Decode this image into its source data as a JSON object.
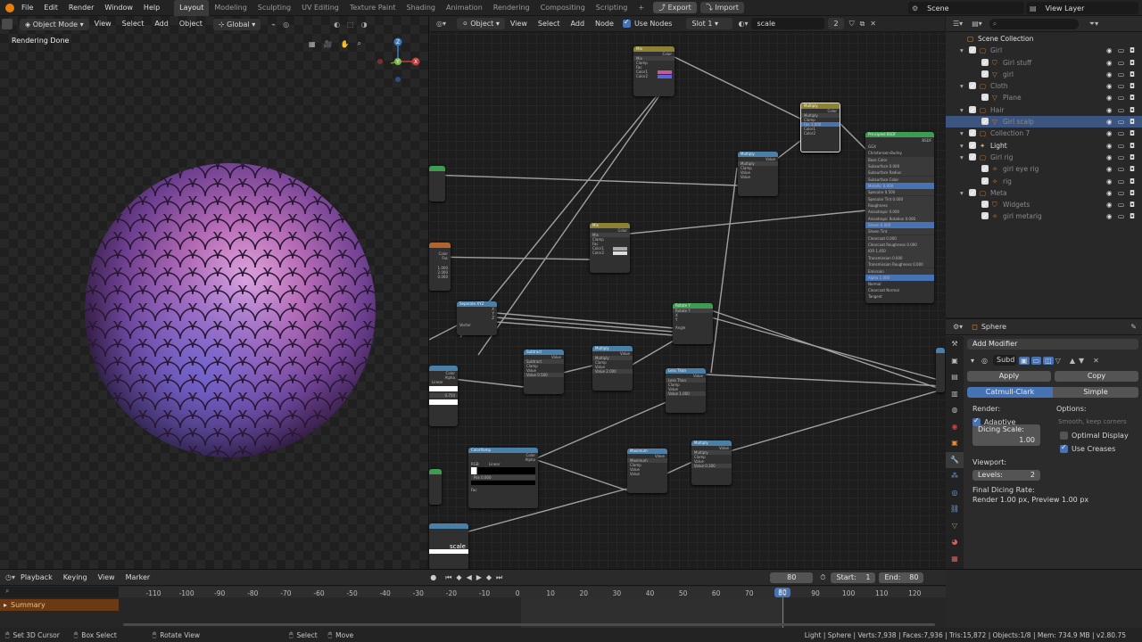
{
  "topbar": {
    "menus": [
      "File",
      "Edit",
      "Render",
      "Window",
      "Help"
    ],
    "workspaces": [
      "Layout",
      "Modeling",
      "Sculpting",
      "UV Editing",
      "Texture Paint",
      "Shading",
      "Animation",
      "Rendering",
      "Compositing",
      "Scripting"
    ],
    "active_workspace": "Layout",
    "plus": "+",
    "export_label": "Export",
    "import_label": "Import",
    "scene_label": "Scene",
    "view_layer_label": "View Layer"
  },
  "viewport": {
    "mode": "Object Mode",
    "menus": [
      "View",
      "Select",
      "Add",
      "Object"
    ],
    "transform": "Global",
    "status_text": "Rendering Done",
    "axis_z": "Z",
    "axis_y": "Y",
    "axis_x": "X"
  },
  "node_editor": {
    "object_dropdown": "Object",
    "menus": [
      "View",
      "Select",
      "Add",
      "Node"
    ],
    "use_nodes_label": "Use Nodes",
    "slot": "Slot 1",
    "material_name": "scale",
    "user_count": "2",
    "nodes": [
      {
        "title": "Mix",
        "color": "#8c8235",
        "rows": [
          "Color",
          "Mix",
          "Clamp",
          "Fac",
          "Color1",
          "Color2"
        ]
      },
      {
        "title": "Multiply",
        "color": "#8c8235",
        "rows": [
          "Color",
          "Multiply",
          "Clamp",
          "Fac 1.000",
          "Color1",
          "Color2"
        ]
      },
      {
        "title": "Principled BSDF",
        "color": "#3e9b52",
        "rows": [
          "BSDF",
          "GGX",
          "Christensen-Burley",
          "Base Color",
          "Subsurface 0.000",
          "Subsurface Radius",
          "Subsurface Color",
          "Metallic 0.000",
          "Specular 0.500",
          "Specular Tint 0.000",
          "Roughness",
          "Anisotropic 0.000",
          "Anisotropic Rotation 0.000",
          "Sheen 0.000",
          "Sheen Tint",
          "Clearcoat 0.000",
          "Clearcoat Roughness 0.000",
          "IOR 1.450",
          "Transmission 0.000",
          "Transmission Roughness 0.000",
          "Emission",
          "Alpha 1.000",
          "Normal",
          "Clearcoat Normal",
          "Tangent"
        ]
      },
      {
        "title": "Multiply",
        "color": "#4a7fa8",
        "rows": [
          "Value",
          "Multiply",
          "Clamp",
          "Value",
          "Value"
        ]
      },
      {
        "title": "Mix",
        "color": "#8c8235",
        "rows": [
          "Color",
          "Mix",
          "Clamp",
          "Fac",
          "Color1",
          "Color2"
        ]
      },
      {
        "title": "Separate XYZ",
        "color": "#4a7fa8",
        "rows": [
          "X",
          "Y",
          "Z",
          "Vector"
        ]
      },
      {
        "title": "Rotate Y",
        "color": "#3e9b52",
        "rows": [
          "Rotate Y",
          "X",
          "Y",
          "Angle"
        ]
      },
      {
        "title": "Subtract",
        "color": "#4a7fa8",
        "rows": [
          "Value",
          "Subtract",
          "Clamp",
          "Value",
          "Value 0.500"
        ]
      },
      {
        "title": "Multiply",
        "color": "#4a7fa8",
        "rows": [
          "Value",
          "Multiply",
          "Clamp",
          "Value",
          "Value 2.000"
        ]
      },
      {
        "title": "Less Than",
        "color": "#4a7fa8",
        "rows": [
          "Value",
          "Less Than",
          "Clamp",
          "Value",
          "Value 1.000"
        ]
      },
      {
        "title": "ColorRamp",
        "color": "#4a7fa8",
        "rows": [
          "Color",
          "Alpha",
          "RGB",
          "Linear",
          "Pos 0.000",
          "Fac"
        ]
      },
      {
        "title": "Maximum",
        "color": "#4a7fa8",
        "rows": [
          "Value",
          "Maximum",
          "Clamp",
          "Value",
          "Value"
        ]
      },
      {
        "title": "Multiply",
        "color": "#4a7fa8",
        "rows": [
          "Value",
          "Multiply",
          "Clamp",
          "Value",
          "Value 0.300"
        ]
      }
    ],
    "partial_labels": [
      "Color",
      "Alpha",
      "Linear",
      "0.750",
      "scale",
      "Color",
      "Fac",
      "1.000",
      "2.000",
      "0.000"
    ]
  },
  "outliner": {
    "rows": [
      {
        "label": "Scene Collection",
        "indent": 0,
        "dim": false,
        "sel": false
      },
      {
        "label": "Girl",
        "indent": 1,
        "dim": true,
        "sel": false
      },
      {
        "label": "Girl stuff",
        "indent": 2,
        "dim": true,
        "sel": false
      },
      {
        "label": "girl",
        "indent": 2,
        "dim": true,
        "sel": false
      },
      {
        "label": "Cloth",
        "indent": 1,
        "dim": true,
        "sel": false
      },
      {
        "label": "Plane",
        "indent": 2,
        "dim": true,
        "sel": false
      },
      {
        "label": "Hair",
        "indent": 1,
        "dim": true,
        "sel": false
      },
      {
        "label": "Girl scalp",
        "indent": 2,
        "dim": true,
        "sel": true
      },
      {
        "label": "Collection 7",
        "indent": 1,
        "dim": true,
        "sel": false
      },
      {
        "label": "Light",
        "indent": 1,
        "dim": false,
        "sel": false
      },
      {
        "label": "Girl rig",
        "indent": 1,
        "dim": true,
        "sel": false
      },
      {
        "label": "girl eye rig",
        "indent": 2,
        "dim": true,
        "sel": false
      },
      {
        "label": "rig",
        "indent": 2,
        "dim": true,
        "sel": false
      },
      {
        "label": "Meta",
        "indent": 1,
        "dim": true,
        "sel": false
      },
      {
        "label": "Widgets",
        "indent": 2,
        "dim": true,
        "sel": false
      },
      {
        "label": "girl metarig",
        "indent": 2,
        "dim": true,
        "sel": false
      }
    ],
    "badge": "2"
  },
  "properties": {
    "object_name": "Sphere",
    "add_modifier": "Add Modifier",
    "modifier_name": "Subd",
    "apply": "Apply",
    "copy": "Copy",
    "catmull": "Catmull-Clark",
    "simple": "Simple",
    "render_label": "Render:",
    "options_label": "Options:",
    "adaptive": "Adaptive",
    "smooth_keep": "Smooth, keep corners",
    "dicing_label": "Dicing Scale:",
    "dicing_value": "1.00",
    "optimal_display": "Optimal Display",
    "use_creases": "Use Creases",
    "viewport_label": "Viewport:",
    "levels_label": "Levels:",
    "levels_value": "2",
    "final_dicing": "Final Dicing Rate:",
    "render_rate": "Render 1.00 px, Preview 1.00 px"
  },
  "timeline": {
    "menus": [
      "Playback",
      "Keying",
      "View",
      "Marker"
    ],
    "current_frame": "80",
    "start_label": "Start:",
    "start_value": "1",
    "end_label": "End:",
    "end_value": "80",
    "ticks": [
      "-110",
      "-100",
      "-90",
      "-80",
      "-70",
      "-60",
      "-50",
      "-40",
      "-30",
      "-20",
      "-10",
      "0",
      "10",
      "20",
      "30",
      "40",
      "50",
      "60",
      "70",
      "80",
      "90",
      "100",
      "110",
      "120"
    ],
    "summary": "Summary"
  },
  "statusbar": {
    "select_cursor": "Set 3D Cursor",
    "box_select": "Box Select",
    "rotate_view": "Rotate View",
    "select": "Select",
    "move": "Move",
    "stats": "Light | Sphere | Verts:7,938 | Faces:7,936 | Tris:15,872 | Objects:1/8 | Mem: 734.9 MB | v2.80.75"
  },
  "colors": {
    "accent": "#4772b3",
    "selection": "#3b5580",
    "header": "#2a2a2a"
  }
}
